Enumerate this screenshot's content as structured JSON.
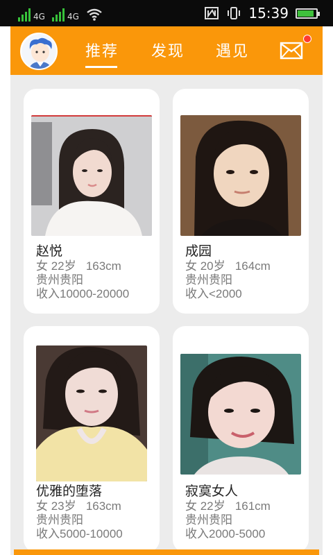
{
  "status_bar": {
    "network_left": "4G",
    "network_right": "4G",
    "time": "15:39",
    "battery_level": 0.9,
    "icons": [
      "signal-icon",
      "wifi-icon",
      "nfc-icon",
      "vibrate-icon",
      "battery-icon"
    ]
  },
  "header": {
    "tabs": [
      {
        "label": "推荐",
        "active": true
      },
      {
        "label": "发现",
        "active": false
      },
      {
        "label": "遇见",
        "active": false
      }
    ],
    "accent_color": "#fa970a",
    "notification_color": "#ff3b30"
  },
  "profiles": [
    {
      "name": "赵悦",
      "gender_age": "女 22岁",
      "height": "163cm",
      "location": "贵州贵阳",
      "income": "收入10000-20000"
    },
    {
      "name": "成园",
      "gender_age": "女 20岁",
      "height": "164cm",
      "location": "贵州贵阳",
      "income": "收入<2000"
    },
    {
      "name": "优雅的堕落",
      "gender_age": "女 23岁",
      "height": "163cm",
      "location": "贵州贵阳",
      "income": "收入5000-10000"
    },
    {
      "name": "寂寞女人",
      "gender_age": "女 22岁",
      "height": "161cm",
      "location": "贵州贵阳",
      "income": "收入2000-5000"
    }
  ]
}
